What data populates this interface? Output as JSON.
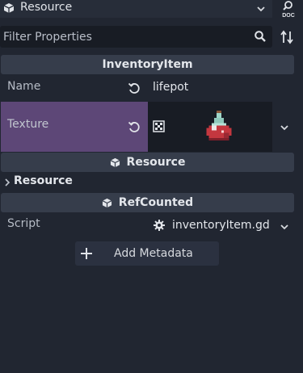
{
  "header": {
    "resource_title": "Resource",
    "doc_icon": "doc-search-icon"
  },
  "filter": {
    "placeholder": "Filter Properties"
  },
  "sections": {
    "inventory_item": "InventoryItem",
    "resource": "Resource",
    "refcounted": "RefCounted"
  },
  "properties": {
    "name_label": "Name",
    "name_value": "lifepot",
    "texture_label": "Texture",
    "resource_group": "Resource",
    "script_label": "Script",
    "script_value": "inventoryItem.gd"
  },
  "actions": {
    "add_metadata": "Add Metadata"
  },
  "colors": {
    "background": "#212631",
    "section": "#363d4b",
    "texture_highlight": "#5d4777",
    "field": "#181c24"
  }
}
